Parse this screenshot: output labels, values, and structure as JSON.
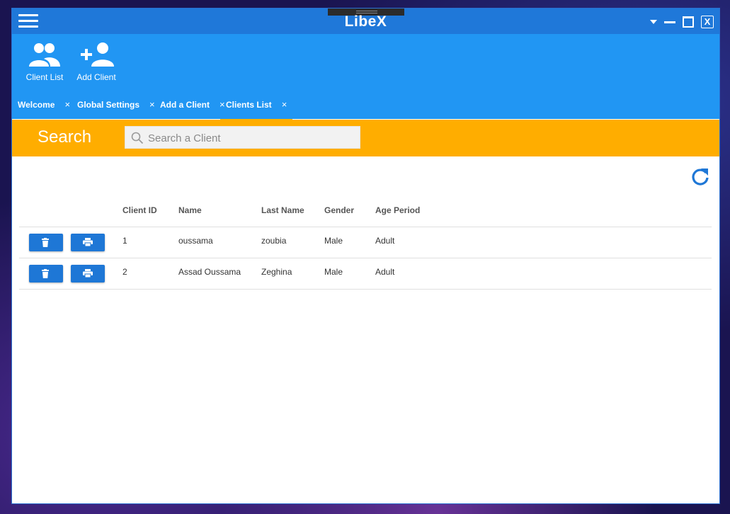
{
  "window": {
    "title": "LibeX",
    "close_label": "X"
  },
  "toolbar": {
    "client_list_label": "Client List",
    "add_client_label": "Add Client"
  },
  "tabs": [
    {
      "label": "Welcome",
      "close": "×",
      "active": false
    },
    {
      "label": "Global Settings",
      "close": "×",
      "active": false
    },
    {
      "label": "Add a Client",
      "close": "×",
      "active": false
    },
    {
      "label": "Clients List",
      "close": "×",
      "active": true
    }
  ],
  "search": {
    "label": "Search",
    "placeholder": "Search a Client",
    "value": ""
  },
  "table": {
    "columns": [
      "Client ID",
      "Name",
      "Last Name",
      "Gender",
      "Age Period"
    ],
    "rows": [
      {
        "id": "1",
        "name": "oussama",
        "last_name": "zoubia",
        "gender": "Male",
        "age_period": "Adult"
      },
      {
        "id": "2",
        "name": "Assad Oussama",
        "last_name": "Zeghina",
        "gender": "Male",
        "age_period": "Adult"
      }
    ]
  },
  "icons": {
    "menu": "hamburger-icon",
    "client_list": "people-icon",
    "add_client": "add-person-icon",
    "search": "search-icon",
    "refresh": "refresh-icon",
    "delete": "trash-icon",
    "print": "printer-icon"
  },
  "colors": {
    "titlebar": "#1f78d9",
    "toolbar": "#2196f3",
    "search_bar": "#ffad00",
    "accent": "#1e77d6",
    "tab_underline": "#f7b500"
  }
}
